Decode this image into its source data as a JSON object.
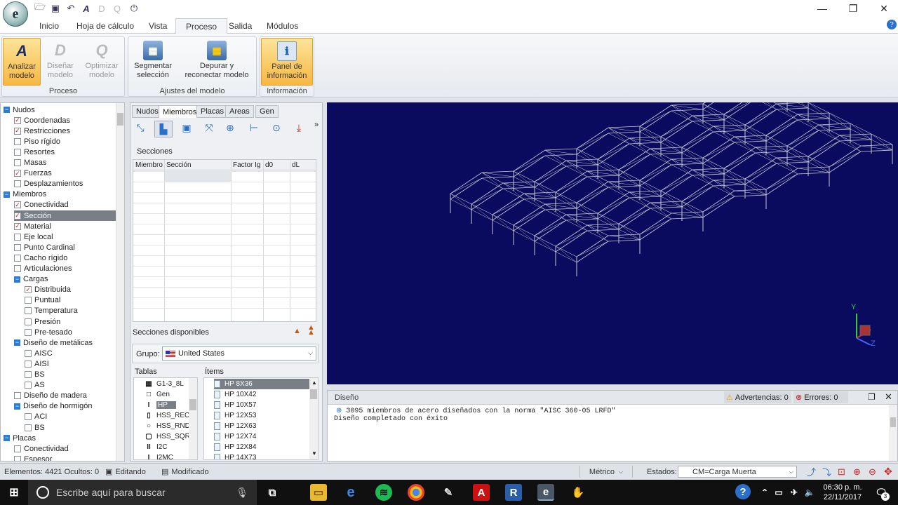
{
  "ribbon_tabs": [
    "Inicio",
    "Hoja de cálculo",
    "Vista",
    "Proceso",
    "Salida",
    "Módulos"
  ],
  "groups": {
    "proceso": {
      "label": "Proceso",
      "buttons": [
        {
          "label": "Analizar\nmodelo"
        },
        {
          "label": "Diseñar\nmodelo"
        },
        {
          "label": "Optimizar\nmodelo"
        }
      ]
    },
    "ajustes": {
      "label": "Ajustes del modelo",
      "buttons": [
        {
          "label": "Segmentar\nselección"
        },
        {
          "label": "Depurar y\nreconectar modelo"
        }
      ]
    },
    "info": {
      "label": "Información",
      "buttons": [
        {
          "label": "Panel de\ninformación"
        }
      ]
    }
  },
  "tree": [
    {
      "label": "Nudos",
      "level": 0,
      "type": "exp"
    },
    {
      "label": "Coordenadas",
      "level": 1,
      "type": "chk",
      "checked": true
    },
    {
      "label": "Restricciones",
      "level": 1,
      "type": "chk",
      "checked": true
    },
    {
      "label": "Piso rígido",
      "level": 1,
      "type": "chk",
      "checked": false
    },
    {
      "label": "Resortes",
      "level": 1,
      "type": "chk",
      "checked": false
    },
    {
      "label": "Masas",
      "level": 1,
      "type": "chk",
      "checked": false
    },
    {
      "label": "Fuerzas",
      "level": 1,
      "type": "chk",
      "checked": true
    },
    {
      "label": "Desplazamientos",
      "level": 1,
      "type": "chk",
      "checked": false
    },
    {
      "label": "Miembros",
      "level": 0,
      "type": "exp"
    },
    {
      "label": "Conectividad",
      "level": 1,
      "type": "chk",
      "checked": true
    },
    {
      "label": "Sección",
      "level": 1,
      "type": "chk",
      "checked": true,
      "selected": true
    },
    {
      "label": "Material",
      "level": 1,
      "type": "chk",
      "checked": true
    },
    {
      "label": "Eje local",
      "level": 1,
      "type": "chk",
      "checked": false
    },
    {
      "label": "Punto Cardinal",
      "level": 1,
      "type": "chk",
      "checked": false
    },
    {
      "label": "Cacho rígido",
      "level": 1,
      "type": "chk",
      "checked": false
    },
    {
      "label": "Articulaciones",
      "level": 1,
      "type": "chk",
      "checked": false
    },
    {
      "label": "Cargas",
      "level": 1,
      "type": "exp"
    },
    {
      "label": "Distribuida",
      "level": 2,
      "type": "chk",
      "checked": true
    },
    {
      "label": "Puntual",
      "level": 2,
      "type": "chk",
      "checked": false
    },
    {
      "label": "Temperatura",
      "level": 2,
      "type": "chk",
      "checked": false
    },
    {
      "label": "Presión",
      "level": 2,
      "type": "chk",
      "checked": false
    },
    {
      "label": "Pre-tesado",
      "level": 2,
      "type": "chk",
      "checked": false
    },
    {
      "label": "Diseño de metálicas",
      "level": 1,
      "type": "exp"
    },
    {
      "label": "AISC",
      "level": 2,
      "type": "chk",
      "checked": false
    },
    {
      "label": "AISI",
      "level": 2,
      "type": "chk",
      "checked": false
    },
    {
      "label": "BS",
      "level": 2,
      "type": "chk",
      "checked": false
    },
    {
      "label": "AS",
      "level": 2,
      "type": "chk",
      "checked": false
    },
    {
      "label": "Diseño de madera",
      "level": 1,
      "type": "chk",
      "checked": false
    },
    {
      "label": "Diseño de hormigón",
      "level": 1,
      "type": "exp"
    },
    {
      "label": "ACI",
      "level": 2,
      "type": "chk",
      "checked": false
    },
    {
      "label": "BS",
      "level": 2,
      "type": "chk",
      "checked": false
    },
    {
      "label": "Placas",
      "level": 0,
      "type": "exp"
    },
    {
      "label": "Conectividad",
      "level": 1,
      "type": "chk",
      "checked": false
    },
    {
      "label": "Espesor",
      "level": 1,
      "type": "chk",
      "checked": false
    }
  ],
  "panel_tabs": [
    "Nudos",
    "Miembros",
    "Placas",
    "Areas",
    "Gen"
  ],
  "secciones_label": "Secciones",
  "table_headers": [
    "Miembro",
    "Sección",
    "Factor Ig",
    "d0",
    "dL"
  ],
  "disponibles_label": "Secciones disponibles",
  "grupo_label": "Grupo:",
  "grupo_value": "United States",
  "tablas_label": "Tablas",
  "items_label": "Ítems",
  "tablas": [
    "G1-3_8L",
    "Gen",
    "HP",
    "HSS_REC",
    "HSS_RND",
    "HSS_SQR",
    "I2C",
    "I2MC"
  ],
  "items": [
    "HP 8X36",
    "HP 10X42",
    "HP 10X57",
    "HP 12X53",
    "HP 12X63",
    "HP 12X74",
    "HP 12X84",
    "HP 14X73"
  ],
  "design": {
    "title": "Diseño",
    "warnings": "Advertencias: 0",
    "errors": "Errores: 0",
    "line1": "3095 miembros de acero diseñados con la norma \"AISC 360-05 LRFD\"",
    "line2": "Diseño completado con éxito"
  },
  "axis": {
    "y": "Y",
    "z": "Z"
  },
  "status": {
    "elements": "Elementos: 4421 Ocultos: 0",
    "mode": "Editando",
    "modified": "Modificado",
    "units": "Métrico",
    "states_label": "Estados:",
    "state_value": "CM=Carga Muerta"
  },
  "taskbar": {
    "search": "Escribe aquí para buscar",
    "time": "06:30 p. m.",
    "date": "22/11/2017",
    "notif": "3"
  }
}
